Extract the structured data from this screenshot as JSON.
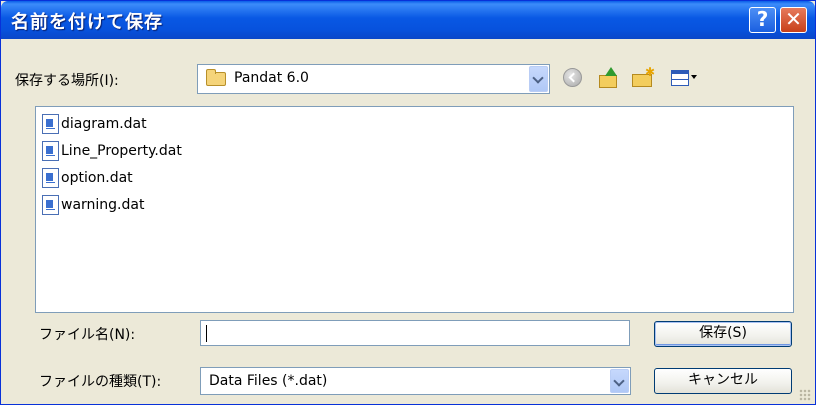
{
  "window": {
    "title": "名前を付けて保存",
    "help_label": "?",
    "close_label": "✕"
  },
  "save_in": {
    "label": "保存する場所(I):",
    "value": "Pandat 6.0"
  },
  "toolbar": {
    "icons": [
      "back-icon",
      "up-folder-icon",
      "new-folder-icon",
      "view-menu-icon"
    ]
  },
  "files": [
    {
      "name": "diagram.dat"
    },
    {
      "name": "Line_Property.dat"
    },
    {
      "name": "option.dat"
    },
    {
      "name": "warning.dat"
    }
  ],
  "file_name": {
    "label": "ファイル名(N):",
    "value": ""
  },
  "file_type": {
    "label": "ファイルの種類(T):",
    "value": "Data Files (*.dat)"
  },
  "buttons": {
    "save": "保存(S)",
    "cancel": "キャンセル"
  },
  "colors": {
    "titlebar": "#0958e4",
    "dialog_bg": "#ece9d8",
    "border": "#7f9db9"
  }
}
